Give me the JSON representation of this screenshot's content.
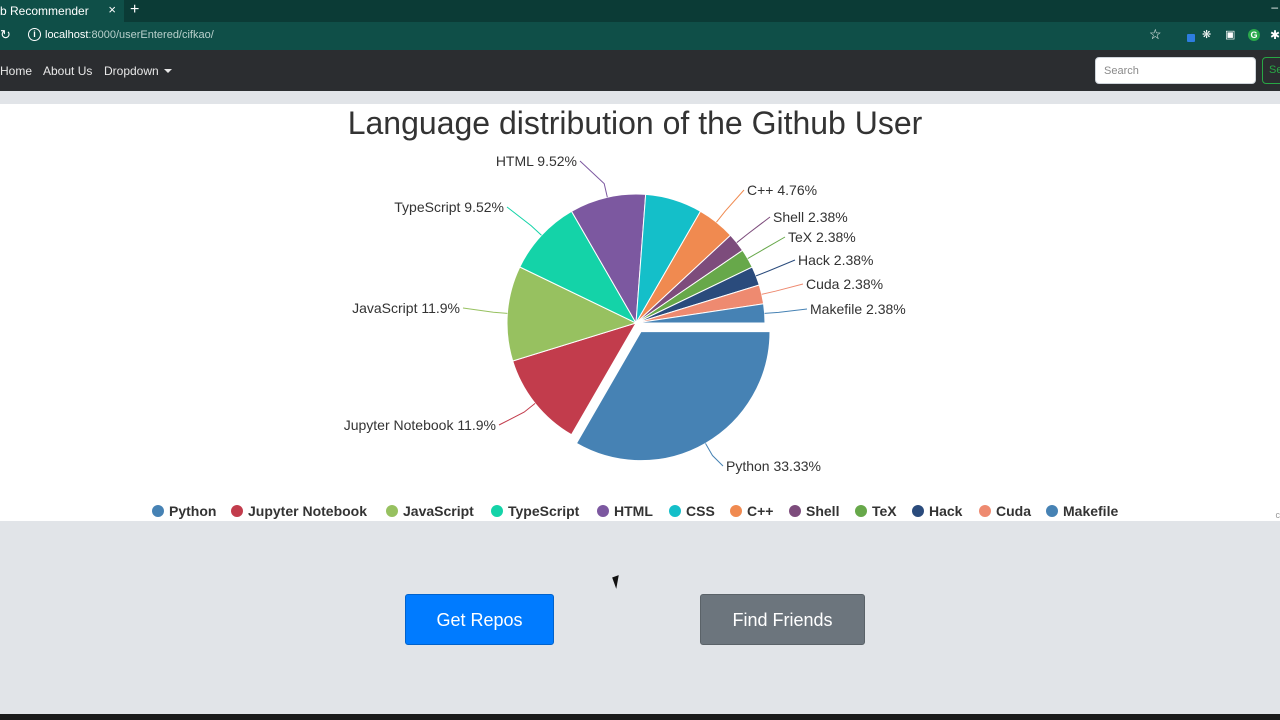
{
  "browser": {
    "tab_title": "b Recommender",
    "tab_close": "×",
    "new_tab": "+",
    "window_control": "–",
    "url_host": "localhost",
    "url_path": ":8000/userEntered/cifkao/",
    "icons": [
      "reload-icon",
      "info-icon",
      "star-icon",
      "extension-icon",
      "grammarly-icon",
      "puzzle-icon"
    ]
  },
  "navbar": {
    "home": "Home",
    "about": "About Us",
    "dropdown": "Dropdown",
    "search_placeholder": "Search",
    "search_button": "Search"
  },
  "chart_data": {
    "type": "pie",
    "title": "Language distribution of the Github User",
    "slices": [
      {
        "name": "Python",
        "value": 33.33,
        "label": "Python  33.33%",
        "color": "#4682b4",
        "exploded": true
      },
      {
        "name": "Jupyter Notebook",
        "value": 11.9,
        "label": "Jupyter Notebook  11.9%",
        "color": "#c23c4c"
      },
      {
        "name": "JavaScript",
        "value": 11.9,
        "label": "JavaScript  11.9%",
        "color": "#97c160"
      },
      {
        "name": "TypeScript",
        "value": 9.52,
        "label": "TypeScript  9.52%",
        "color": "#14d3a8"
      },
      {
        "name": "HTML",
        "value": 9.52,
        "label": "HTML  9.52%",
        "color": "#7c58a0"
      },
      {
        "name": "CSS",
        "value": 7.14,
        "label": "",
        "color": "#14bfc9"
      },
      {
        "name": "C++",
        "value": 4.76,
        "label": "C++  4.76%",
        "color": "#f08a50"
      },
      {
        "name": "Shell",
        "value": 2.38,
        "label": "Shell  2.38%",
        "color": "#7d4c7c"
      },
      {
        "name": "TeX",
        "value": 2.38,
        "label": "TeX  2.38%",
        "color": "#67a84a"
      },
      {
        "name": "Hack",
        "value": 2.38,
        "label": "Hack  2.38%",
        "color": "#2a4b7c"
      },
      {
        "name": "Cuda",
        "value": 2.38,
        "label": "Cuda  2.38%",
        "color": "#ee8a70"
      },
      {
        "name": "Makefile",
        "value": 2.38,
        "label": "Makefile  2.38%",
        "color": "#4682b4"
      }
    ],
    "legend_position": "bottom",
    "legend": [
      "Python",
      "Jupyter Notebook",
      "JavaScript",
      "TypeScript",
      "HTML",
      "CSS",
      "C++",
      "Shell",
      "TeX",
      "Hack",
      "Cuda",
      "Makefile"
    ]
  },
  "actions": {
    "get_repos": "Get Repos",
    "find_friends": "Find Friends"
  },
  "footer_mark": "c"
}
